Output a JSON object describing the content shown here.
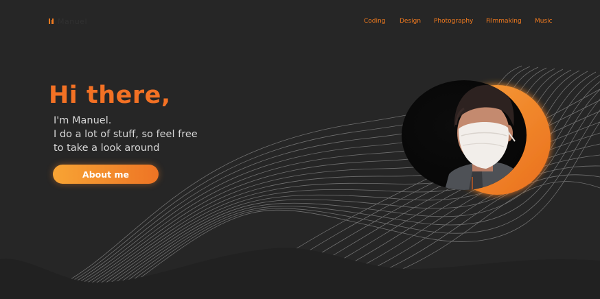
{
  "header": {
    "logo_text": "Manuel",
    "nav": [
      "Coding",
      "Design",
      "Photography",
      "Filmmaking",
      "Music"
    ]
  },
  "hero": {
    "title": "Hi there,",
    "lines": [
      "I'm Manuel.",
      "I do a lot of stuff, so feel free",
      "to take a look around"
    ],
    "button_label": "About me"
  },
  "colors": {
    "background": "#262626",
    "accent": "#f37124",
    "button_start": "#f8a434",
    "button_end": "#ee7424",
    "text": "#d8d8d8"
  },
  "icons": {
    "logo": "bars-logo-icon"
  },
  "portrait": {
    "subject": "person-photo"
  }
}
